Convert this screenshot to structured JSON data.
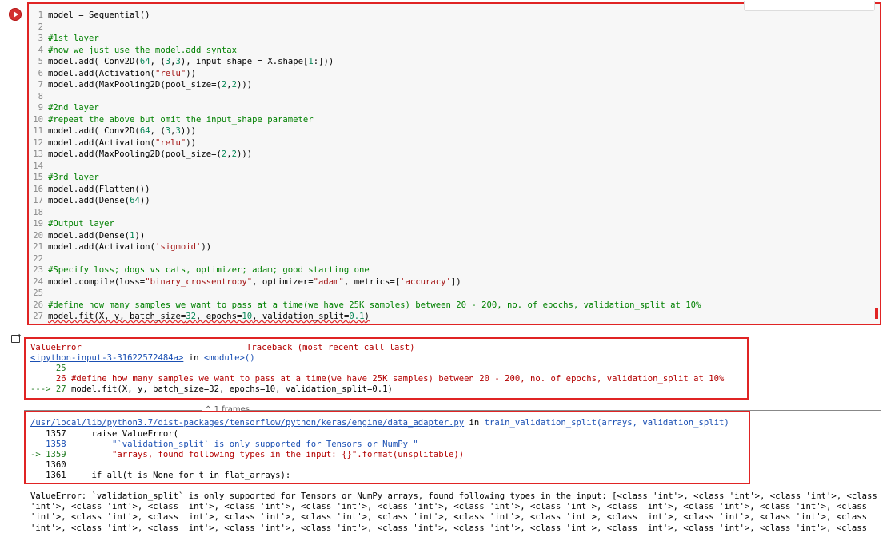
{
  "code_cell": {
    "lines": [
      {
        "n": "1",
        "segments": [
          {
            "t": "model = Sequential()",
            "c": "tx"
          }
        ]
      },
      {
        "n": "2",
        "segments": []
      },
      {
        "n": "3",
        "segments": [
          {
            "t": "#1st layer",
            "c": "cm"
          }
        ]
      },
      {
        "n": "4",
        "segments": [
          {
            "t": "#now we just use the model.add syntax",
            "c": "cm"
          }
        ]
      },
      {
        "n": "5",
        "segments": [
          {
            "t": "model.add( Conv2D(",
            "c": "tx"
          },
          {
            "t": "64",
            "c": "nu"
          },
          {
            "t": ", (",
            "c": "tx"
          },
          {
            "t": "3",
            "c": "nu"
          },
          {
            "t": ",",
            "c": "tx"
          },
          {
            "t": "3",
            "c": "nu"
          },
          {
            "t": "), input_shape = X.shape[",
            "c": "tx"
          },
          {
            "t": "1",
            "c": "nu"
          },
          {
            "t": ":]))",
            "c": "tx"
          }
        ]
      },
      {
        "n": "6",
        "segments": [
          {
            "t": "model.add(Activation(",
            "c": "tx"
          },
          {
            "t": "\"relu\"",
            "c": "st"
          },
          {
            "t": "))",
            "c": "tx"
          }
        ]
      },
      {
        "n": "7",
        "segments": [
          {
            "t": "model.add(MaxPooling2D(pool_size=(",
            "c": "tx"
          },
          {
            "t": "2",
            "c": "nu"
          },
          {
            "t": ",",
            "c": "tx"
          },
          {
            "t": "2",
            "c": "nu"
          },
          {
            "t": ")))",
            "c": "tx"
          }
        ]
      },
      {
        "n": "8",
        "segments": []
      },
      {
        "n": "9",
        "segments": [
          {
            "t": "#2nd layer",
            "c": "cm"
          }
        ]
      },
      {
        "n": "10",
        "segments": [
          {
            "t": "#repeat the above but omit the input_shape parameter",
            "c": "cm"
          }
        ]
      },
      {
        "n": "11",
        "segments": [
          {
            "t": "model.add( Conv2D(",
            "c": "tx"
          },
          {
            "t": "64",
            "c": "nu"
          },
          {
            "t": ", (",
            "c": "tx"
          },
          {
            "t": "3",
            "c": "nu"
          },
          {
            "t": ",",
            "c": "tx"
          },
          {
            "t": "3",
            "c": "nu"
          },
          {
            "t": ")))",
            "c": "tx"
          }
        ]
      },
      {
        "n": "12",
        "segments": [
          {
            "t": "model.add(Activation(",
            "c": "tx"
          },
          {
            "t": "\"relu\"",
            "c": "st"
          },
          {
            "t": "))",
            "c": "tx"
          }
        ]
      },
      {
        "n": "13",
        "segments": [
          {
            "t": "model.add(MaxPooling2D(pool_size=(",
            "c": "tx"
          },
          {
            "t": "2",
            "c": "nu"
          },
          {
            "t": ",",
            "c": "tx"
          },
          {
            "t": "2",
            "c": "nu"
          },
          {
            "t": ")))",
            "c": "tx"
          }
        ]
      },
      {
        "n": "14",
        "segments": []
      },
      {
        "n": "15",
        "segments": [
          {
            "t": "#3rd layer",
            "c": "cm"
          }
        ]
      },
      {
        "n": "16",
        "segments": [
          {
            "t": "model.add(Flatten())",
            "c": "tx"
          }
        ]
      },
      {
        "n": "17",
        "segments": [
          {
            "t": "model.add(Dense(",
            "c": "tx"
          },
          {
            "t": "64",
            "c": "nu"
          },
          {
            "t": "))",
            "c": "tx"
          }
        ]
      },
      {
        "n": "18",
        "segments": []
      },
      {
        "n": "19",
        "segments": [
          {
            "t": "#Output layer",
            "c": "cm"
          }
        ]
      },
      {
        "n": "20",
        "segments": [
          {
            "t": "model.add(Dense(",
            "c": "tx"
          },
          {
            "t": "1",
            "c": "nu"
          },
          {
            "t": "))",
            "c": "tx"
          }
        ]
      },
      {
        "n": "21",
        "segments": [
          {
            "t": "model.add(Activation(",
            "c": "tx"
          },
          {
            "t": "'sigmoid'",
            "c": "st"
          },
          {
            "t": "))",
            "c": "tx"
          }
        ]
      },
      {
        "n": "22",
        "segments": []
      },
      {
        "n": "23",
        "segments": [
          {
            "t": "#Specify loss; dogs vs cats, optimizer; adam; good starting one",
            "c": "cm"
          }
        ]
      },
      {
        "n": "24",
        "segments": [
          {
            "t": "model.compile(loss=",
            "c": "tx"
          },
          {
            "t": "\"binary_crossentropy\"",
            "c": "st"
          },
          {
            "t": ", optimizer=",
            "c": "tx"
          },
          {
            "t": "\"adam\"",
            "c": "st"
          },
          {
            "t": ", metrics=[",
            "c": "tx"
          },
          {
            "t": "'accuracy'",
            "c": "st"
          },
          {
            "t": "])",
            "c": "tx"
          }
        ]
      },
      {
        "n": "25",
        "segments": []
      },
      {
        "n": "26",
        "segments": [
          {
            "t": "#define how many samples we want to pass at a time(we have 25K samples) between 20 - 200, no. of epochs, validation_split at 10%",
            "c": "cm"
          }
        ]
      },
      {
        "n": "27",
        "segments": [
          {
            "t": "model.fit(X, y, batch_size=",
            "c": "tx squig"
          },
          {
            "t": "32",
            "c": "nu squig"
          },
          {
            "t": ", epochs=",
            "c": "tx squig"
          },
          {
            "t": "10",
            "c": "nu squig"
          },
          {
            "t": ", validation_split=",
            "c": "tx squig"
          },
          {
            "t": "0.1",
            "c": "nu squig"
          },
          {
            "t": ")",
            "c": "tx squig"
          }
        ]
      }
    ]
  },
  "traceback": {
    "error_name": "ValueError",
    "header_right": "Traceback (most recent call last)",
    "location_link": "<ipython-input-3-31622572484a>",
    "location_in": " in ",
    "location_module": "<module>()",
    "line_25": "     25",
    "line_26": "     26 #define how many samples we want to pass at a time(we have 25K samples) between 20 - 200, no. of epochs, validation_split at 10%",
    "line_27_arrow": "---> 27 ",
    "line_27_code": "model.fit(X, y, batch_size=32, epochs=10, validation_split=0.1)"
  },
  "frames_label": "1 frames",
  "frame": {
    "path_link": "/usr/local/lib/python3.7/dist-packages/tensorflow/python/keras/engine/data_adapter.py",
    "in_text": " in ",
    "func": "train_validation_split(arrays, validation_split)",
    "l1357": "   1357     raise ValueError(",
    "l1358": "   1358         \"`validation_split` is only supported for Tensors or NumPy \"",
    "l1359_arrow": "-> 1359 ",
    "l1359_code": "        \"arrays, found following types in the input: {}\".format(unsplitable))",
    "l1360": "   1360",
    "l1361": "   1361     if all(t is None for t in flat_arrays):"
  },
  "final_error": {
    "lines": [
      "ValueError: `validation_split` is only supported for Tensors or NumPy arrays, found following types in the input: [<class 'int'>, <class 'int'>, <class 'int'>, <class",
      "'int'>, <class 'int'>, <class 'int'>, <class 'int'>, <class 'int'>, <class 'int'>, <class 'int'>, <class 'int'>, <class 'int'>, <class 'int'>, <class 'int'>, <class",
      "'int'>, <class 'int'>, <class 'int'>, <class 'int'>, <class 'int'>, <class 'int'>, <class 'int'>, <class 'int'>, <class 'int'>, <class 'int'>, <class 'int'>, <class",
      "'int'>, <class 'int'>, <class 'int'>, <class 'int'>, <class 'int'>, <class 'int'>, <class 'int'>, <class 'int'>, <class 'int'>, <class 'int'>, <class 'int'>, <class"
    ]
  }
}
